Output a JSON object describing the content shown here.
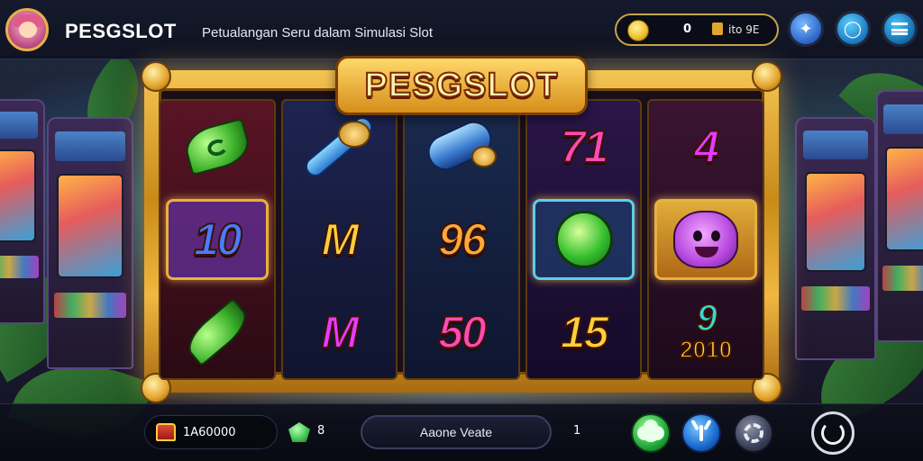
{
  "header": {
    "brand": "PESGSLOT",
    "tagline": "Petualangan Seru dalam Simulasi Slot",
    "balance": {
      "value": "0",
      "amount": "ito 9E"
    }
  },
  "machine": {
    "logo": "PESGSLOT",
    "reels": [
      {
        "symbols": [
          {
            "type": "icon",
            "icon": "green-gem-icon"
          },
          {
            "type": "text",
            "text": "10",
            "color": "#4a7cff"
          },
          {
            "type": "icon",
            "icon": "green-leaf-icon"
          }
        ]
      },
      {
        "symbols": [
          {
            "type": "icon",
            "icon": "blue-bone-icon"
          },
          {
            "type": "text",
            "text": "M",
            "color": "#ffcf3a"
          },
          {
            "type": "text",
            "text": "M",
            "color": "#e83aff"
          }
        ]
      },
      {
        "symbols": [
          {
            "type": "icon",
            "icon": "blue-tube-icon"
          },
          {
            "type": "text",
            "text": "96",
            "color": "#ffa83a"
          },
          {
            "type": "text",
            "text": "50",
            "color": "#ff4ab8"
          }
        ]
      },
      {
        "symbols": [
          {
            "type": "text",
            "text": "71",
            "color": "#ff4ab8"
          },
          {
            "type": "icon",
            "icon": "green-orb-icon"
          },
          {
            "type": "text",
            "text": "15",
            "color": "#ffcf3a"
          }
        ]
      },
      {
        "symbols": [
          {
            "type": "text",
            "text": "4",
            "color": "#e83aff"
          },
          {
            "type": "icon",
            "icon": "purple-monster-icon"
          },
          {
            "type": "text",
            "text": "9",
            "color": "#3ad8d0",
            "sub": "2010"
          }
        ]
      }
    ]
  },
  "footer": {
    "credit": "1A60000",
    "gems": "8",
    "action_label": "Aaone Veate",
    "page": "1"
  },
  "colors": {
    "accent_gold": "#f0b840",
    "background": "#0c0f1c",
    "spin_ring": "#d8dce8"
  }
}
